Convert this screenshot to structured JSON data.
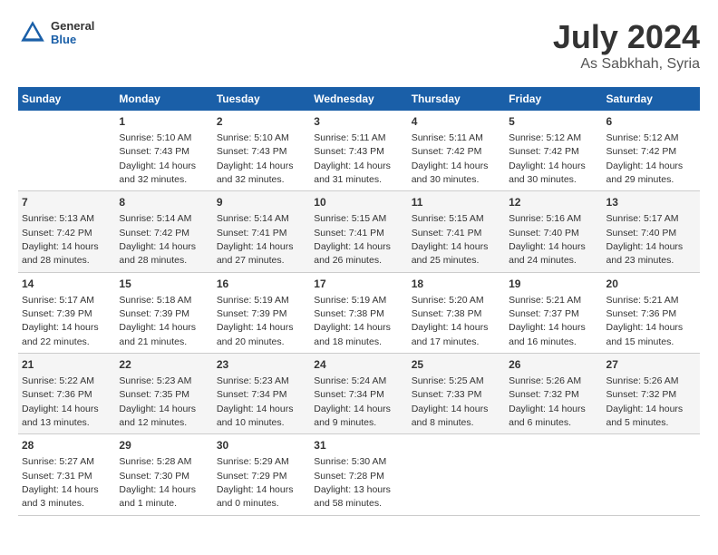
{
  "logo": {
    "general": "General",
    "blue": "Blue"
  },
  "title": "July 2024",
  "subtitle": "As Sabkhah, Syria",
  "headers": [
    "Sunday",
    "Monday",
    "Tuesday",
    "Wednesday",
    "Thursday",
    "Friday",
    "Saturday"
  ],
  "weeks": [
    [
      {
        "day": "",
        "info": ""
      },
      {
        "day": "1",
        "info": "Sunrise: 5:10 AM\nSunset: 7:43 PM\nDaylight: 14 hours\nand 32 minutes."
      },
      {
        "day": "2",
        "info": "Sunrise: 5:10 AM\nSunset: 7:43 PM\nDaylight: 14 hours\nand 32 minutes."
      },
      {
        "day": "3",
        "info": "Sunrise: 5:11 AM\nSunset: 7:43 PM\nDaylight: 14 hours\nand 31 minutes."
      },
      {
        "day": "4",
        "info": "Sunrise: 5:11 AM\nSunset: 7:42 PM\nDaylight: 14 hours\nand 30 minutes."
      },
      {
        "day": "5",
        "info": "Sunrise: 5:12 AM\nSunset: 7:42 PM\nDaylight: 14 hours\nand 30 minutes."
      },
      {
        "day": "6",
        "info": "Sunrise: 5:12 AM\nSunset: 7:42 PM\nDaylight: 14 hours\nand 29 minutes."
      }
    ],
    [
      {
        "day": "7",
        "info": "Sunrise: 5:13 AM\nSunset: 7:42 PM\nDaylight: 14 hours\nand 28 minutes."
      },
      {
        "day": "8",
        "info": "Sunrise: 5:14 AM\nSunset: 7:42 PM\nDaylight: 14 hours\nand 28 minutes."
      },
      {
        "day": "9",
        "info": "Sunrise: 5:14 AM\nSunset: 7:41 PM\nDaylight: 14 hours\nand 27 minutes."
      },
      {
        "day": "10",
        "info": "Sunrise: 5:15 AM\nSunset: 7:41 PM\nDaylight: 14 hours\nand 26 minutes."
      },
      {
        "day": "11",
        "info": "Sunrise: 5:15 AM\nSunset: 7:41 PM\nDaylight: 14 hours\nand 25 minutes."
      },
      {
        "day": "12",
        "info": "Sunrise: 5:16 AM\nSunset: 7:40 PM\nDaylight: 14 hours\nand 24 minutes."
      },
      {
        "day": "13",
        "info": "Sunrise: 5:17 AM\nSunset: 7:40 PM\nDaylight: 14 hours\nand 23 minutes."
      }
    ],
    [
      {
        "day": "14",
        "info": "Sunrise: 5:17 AM\nSunset: 7:39 PM\nDaylight: 14 hours\nand 22 minutes."
      },
      {
        "day": "15",
        "info": "Sunrise: 5:18 AM\nSunset: 7:39 PM\nDaylight: 14 hours\nand 21 minutes."
      },
      {
        "day": "16",
        "info": "Sunrise: 5:19 AM\nSunset: 7:39 PM\nDaylight: 14 hours\nand 20 minutes."
      },
      {
        "day": "17",
        "info": "Sunrise: 5:19 AM\nSunset: 7:38 PM\nDaylight: 14 hours\nand 18 minutes."
      },
      {
        "day": "18",
        "info": "Sunrise: 5:20 AM\nSunset: 7:38 PM\nDaylight: 14 hours\nand 17 minutes."
      },
      {
        "day": "19",
        "info": "Sunrise: 5:21 AM\nSunset: 7:37 PM\nDaylight: 14 hours\nand 16 minutes."
      },
      {
        "day": "20",
        "info": "Sunrise: 5:21 AM\nSunset: 7:36 PM\nDaylight: 14 hours\nand 15 minutes."
      }
    ],
    [
      {
        "day": "21",
        "info": "Sunrise: 5:22 AM\nSunset: 7:36 PM\nDaylight: 14 hours\nand 13 minutes."
      },
      {
        "day": "22",
        "info": "Sunrise: 5:23 AM\nSunset: 7:35 PM\nDaylight: 14 hours\nand 12 minutes."
      },
      {
        "day": "23",
        "info": "Sunrise: 5:23 AM\nSunset: 7:34 PM\nDaylight: 14 hours\nand 10 minutes."
      },
      {
        "day": "24",
        "info": "Sunrise: 5:24 AM\nSunset: 7:34 PM\nDaylight: 14 hours\nand 9 minutes."
      },
      {
        "day": "25",
        "info": "Sunrise: 5:25 AM\nSunset: 7:33 PM\nDaylight: 14 hours\nand 8 minutes."
      },
      {
        "day": "26",
        "info": "Sunrise: 5:26 AM\nSunset: 7:32 PM\nDaylight: 14 hours\nand 6 minutes."
      },
      {
        "day": "27",
        "info": "Sunrise: 5:26 AM\nSunset: 7:32 PM\nDaylight: 14 hours\nand 5 minutes."
      }
    ],
    [
      {
        "day": "28",
        "info": "Sunrise: 5:27 AM\nSunset: 7:31 PM\nDaylight: 14 hours\nand 3 minutes."
      },
      {
        "day": "29",
        "info": "Sunrise: 5:28 AM\nSunset: 7:30 PM\nDaylight: 14 hours\nand 1 minute."
      },
      {
        "day": "30",
        "info": "Sunrise: 5:29 AM\nSunset: 7:29 PM\nDaylight: 14 hours\nand 0 minutes."
      },
      {
        "day": "31",
        "info": "Sunrise: 5:30 AM\nSunset: 7:28 PM\nDaylight: 13 hours\nand 58 minutes."
      },
      {
        "day": "",
        "info": ""
      },
      {
        "day": "",
        "info": ""
      },
      {
        "day": "",
        "info": ""
      }
    ]
  ]
}
